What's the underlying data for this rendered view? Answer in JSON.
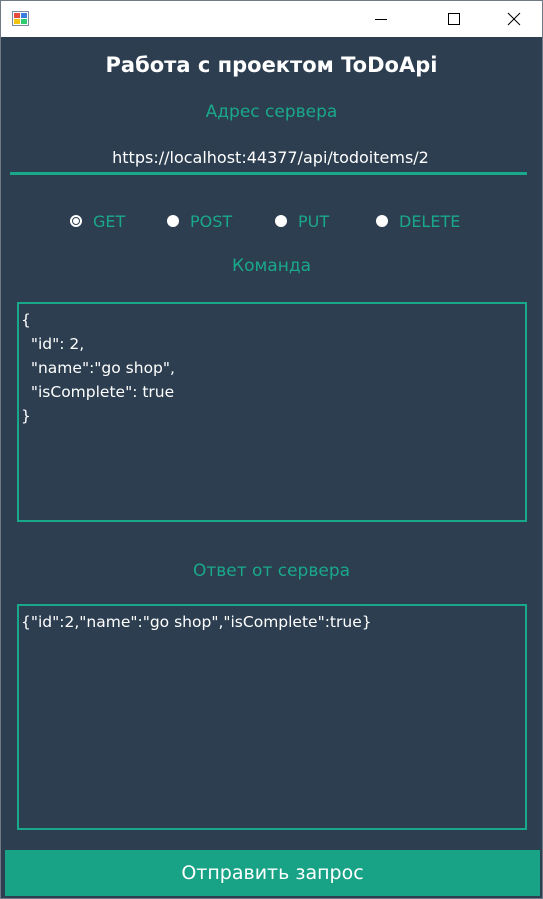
{
  "window": {
    "icon": "winforms-app-icon",
    "controls": {
      "minimize": "minimize-icon",
      "maximize": "maximize-icon",
      "close": "close-icon"
    }
  },
  "title": "Работа с проектом ToDoApi",
  "address": {
    "label": "Адрес сервера",
    "value": "https://localhost:44377/api/todoitems/2"
  },
  "methods": [
    {
      "label": "GET",
      "checked": true
    },
    {
      "label": "POST",
      "checked": false
    },
    {
      "label": "PUT",
      "checked": false
    },
    {
      "label": "DELETE",
      "checked": false
    }
  ],
  "command": {
    "label": "Команда",
    "value": "{\n  \"id\": 2,\n  \"name\":\"go shop\",\n  \"isComplete\": true\n}"
  },
  "response": {
    "label": "Ответ от сервера",
    "value": "{\"id\":2,\"name\":\"go shop\",\"isComplete\":true}"
  },
  "send_button": "Отправить запрос",
  "colors": {
    "background": "#2c3e50",
    "accent": "#1aa88b",
    "button": "#18a386",
    "text": "#ffffff"
  }
}
